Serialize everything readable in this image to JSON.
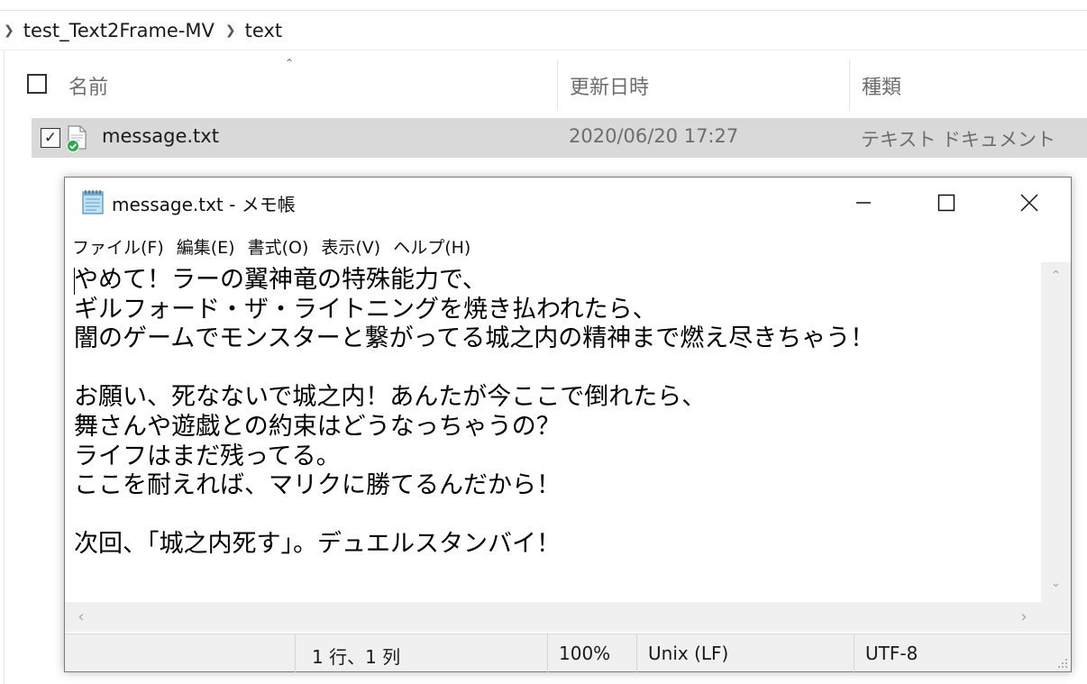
{
  "breadcrumb": {
    "items": [
      "test_Text2Frame-MV",
      "text"
    ]
  },
  "columns": {
    "name": "名前",
    "date": "更新日時",
    "type": "種類"
  },
  "file": {
    "name": "message.txt",
    "date": "2020/06/20 17:27",
    "type": "テキスト ドキュメント",
    "checkmark": "✓"
  },
  "notepad": {
    "title": "message.txt - メモ帳",
    "menu": [
      "ファイル(F)",
      "編集(E)",
      "書式(O)",
      "表示(V)",
      "ヘルプ(H)"
    ],
    "content": "やめて！ラーの翼神竜の特殊能力で、\nギルフォード・ザ・ライトニングを焼き払われたら、\n闇のゲームでモンスターと繋がってる城之内の精神まで燃え尽きちゃう！\n\nお願い、死なないで城之内！あんたが今ここで倒れたら、\n舞さんや遊戯との約束はどうなっちゃうの？\nライフはまだ残ってる。\nここを耐えれば、マリクに勝てるんだから！\n\n次回、「城之内死す」。デュエルスタンバイ！",
    "status": {
      "position": "1 行、1 列",
      "zoom": "100%",
      "line_ending": "Unix (LF)",
      "encoding": "UTF-8"
    }
  },
  "icons": {
    "breadcrumb_sep": "chevron-right-icon",
    "sort": "chevron-up-icon",
    "file": "text-file-icon",
    "sync": "sync-ok-icon",
    "app": "notepad-icon",
    "minimize": "minimize-icon",
    "maximize": "maximize-icon",
    "close": "close-icon"
  },
  "colors": {
    "selected_row": "#d9d9d9",
    "sync_ok": "#2ca84a",
    "status_bar": "#f0f0f0"
  }
}
